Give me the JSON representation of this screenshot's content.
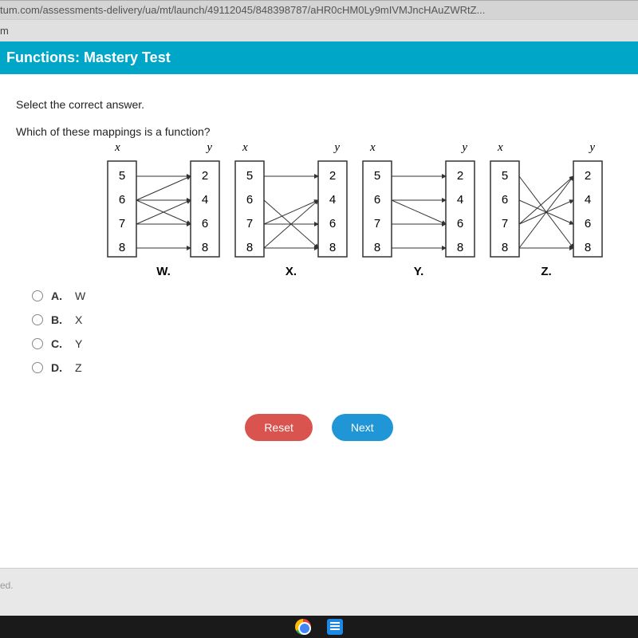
{
  "url": "tum.com/assessments-delivery/ua/mt/launch/49112045/848398787/aHR0cHM0Ly9mIVMJncHAuZWRtZ...",
  "tab": "m",
  "title": "Functions: Mastery Test",
  "instruction": "Select the correct answer.",
  "question": "Which of these mappings is a function?",
  "xlabel": "x",
  "ylabel": "y",
  "mappings": {
    "W": {
      "label": "W.",
      "x": [
        "5",
        "6",
        "7",
        "8"
      ],
      "y": [
        "2",
        "4",
        "6",
        "8"
      ]
    },
    "X": {
      "label": "X.",
      "x": [
        "5",
        "6",
        "7",
        "8"
      ],
      "y": [
        "2",
        "4",
        "6",
        "8"
      ]
    },
    "Y": {
      "label": "Y.",
      "x": [
        "5",
        "6",
        "7",
        "8"
      ],
      "y": [
        "2",
        "4",
        "6",
        "8"
      ]
    },
    "Z": {
      "label": "Z.",
      "x": [
        "5",
        "6",
        "7",
        "8"
      ],
      "y": [
        "2",
        "4",
        "6",
        "8"
      ]
    }
  },
  "options": [
    {
      "letter": "A.",
      "text": "W"
    },
    {
      "letter": "B.",
      "text": "X"
    },
    {
      "letter": "C.",
      "text": "Y"
    },
    {
      "letter": "D.",
      "text": "Z"
    }
  ],
  "buttons": {
    "reset": "Reset",
    "next": "Next"
  },
  "footer": "ed."
}
